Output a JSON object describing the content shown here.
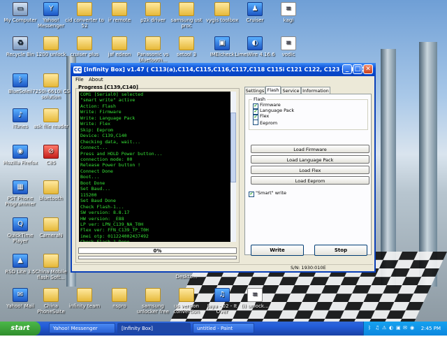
{
  "desktop_icons": [
    {
      "label": "My Computer",
      "kind": "pc",
      "glyph": "▭"
    },
    {
      "label": "Yahoo! Messenger",
      "kind": "app",
      "glyph": "Y"
    },
    {
      "label": "cid converter to 52",
      "kind": "folder",
      "glyph": ""
    },
    {
      "label": "ir remote",
      "kind": "folder",
      "glyph": ""
    },
    {
      "label": "p2k driver",
      "kind": "folder",
      "glyph": ""
    },
    {
      "label": "samsung ust proc",
      "kind": "folder",
      "glyph": ""
    },
    {
      "label": "vygis toolbox",
      "kind": "folder",
      "glyph": ""
    },
    {
      "label": "Cruiser",
      "kind": "app",
      "glyph": "♟"
    },
    {
      "label": "kagi",
      "kind": "doc",
      "glyph": "≡"
    },
    {
      "label": "Recycle Bin",
      "kind": "pc",
      "glyph": "♻"
    },
    {
      "label": "1200 unlock",
      "kind": "folder",
      "glyph": ""
    },
    {
      "label": "cruiser plus",
      "kind": "folder",
      "glyph": ""
    },
    {
      "label": "jaf edeon",
      "kind": "folder",
      "glyph": ""
    },
    {
      "label": "Panasonic vs bluetooth...",
      "kind": "folder",
      "glyph": ""
    },
    {
      "label": "setool 3",
      "kind": "folder",
      "glyph": ""
    },
    {
      "label": "IMEIcheck",
      "kind": "app",
      "glyph": "▣"
    },
    {
      "label": "LimeWire 4.16.6",
      "kind": "app",
      "glyph": "◐"
    },
    {
      "label": "vodic",
      "kind": "doc",
      "glyph": "≡"
    },
    {
      "label": "BlueSoleil",
      "kind": "app",
      "glyph": "ᛒ"
    },
    {
      "label": "7250i-6610i CS solution",
      "kind": "folder",
      "glyph": ""
    },
    {
      "label": "iTunes",
      "kind": "app",
      "glyph": "♪"
    },
    {
      "label": "ask file reader",
      "kind": "folder",
      "glyph": ""
    },
    {
      "label": "Mozilla Firefox",
      "kind": "app",
      "glyph": "◉"
    },
    {
      "label": "C85",
      "kind": "red",
      "glyph": "⊘"
    },
    {
      "label": "PST Phone Programmer",
      "kind": "app",
      "glyph": "▦"
    },
    {
      "label": "bluetooth",
      "kind": "folder",
      "glyph": ""
    },
    {
      "label": "QuickTime Player",
      "kind": "app",
      "glyph": "Q"
    },
    {
      "label": "CameraN",
      "kind": "folder",
      "glyph": ""
    },
    {
      "label": "RSD Lite 3.5",
      "kind": "app",
      "glyph": "▲"
    },
    {
      "label": "China Mobile flash Soft...",
      "kind": "folder",
      "glyph": ""
    },
    {
      "label": "Yahoo! Mail",
      "kind": "app",
      "glyph": "✉"
    },
    {
      "label": "China PhoneSuite",
      "kind": "folder",
      "glyph": ""
    },
    {
      "label": "infinity team",
      "kind": "folder",
      "glyph": ""
    },
    {
      "label": "nspro",
      "kind": "folder",
      "glyph": ""
    },
    {
      "label": "samsung unlocker free",
      "kind": "folder",
      "glyph": ""
    },
    {
      "label": "us version convertion",
      "kind": "folder",
      "glyph": ""
    },
    {
      "label": "Jaya - 02 - It Over",
      "kind": "app",
      "glyph": "♫"
    },
    {
      "label": "(i) unlock...",
      "kind": "doc",
      "glyph": "≡"
    },
    {
      "label": "Deskto...",
      "kind": "folder",
      "glyph": ""
    }
  ],
  "window": {
    "logo": "CC",
    "title": "[Infinity Box] v1.47    ( C113(a),C114,C115,C116,C117,C118 C115i C121 C122, C123 C136 C...",
    "minimize": "_",
    "maximize": "□",
    "close": "✕",
    "menu": [
      "File",
      "About"
    ],
    "progress_title": "Progress [C139,C140]",
    "log": [
      "COM1 [Serial0] selected",
      "\"smart write\" active",
      "Action: Flash",
      "Write: Firmware",
      "Write: Language Pack",
      "Write: Flex",
      "Skip: Eeprom",
      "Device: C139,C140",
      "Checking data, wait...",
      "Connect...",
      "Press and HOLD Power button...",
      "connection mode: 00",
      "Release Power button !",
      "Connect Done",
      "Boot...",
      "Boot Done",
      "Set Baud...",
      "115200",
      "Set Baud Done",
      "Check Flash-1...",
      "SW version: 8.8.17",
      "HW version: _E88",
      "LP ver: LPN_C139_NA_T0H",
      "Flex ver: FFN_C139_TP_T0H",
      "imei otp: 011224002437492",
      "Check Flash-1 Done"
    ],
    "progress_text": "0%",
    "progress_fraction": 0.0,
    "tabs": [
      {
        "label": "Settings",
        "active": false
      },
      {
        "label": "Flash",
        "active": true
      },
      {
        "label": "Service",
        "active": false
      },
      {
        "label": "Information",
        "active": false
      }
    ],
    "flash_group_label": "Flash",
    "checkboxes": [
      {
        "label": "Firmware",
        "checked": true
      },
      {
        "label": "Language Pack",
        "checked": true
      },
      {
        "label": "Flex",
        "checked": true
      },
      {
        "label": "Eeprom",
        "checked": false
      }
    ],
    "panel_buttons": [
      "Load Firmware",
      "Load Language Pack",
      "Load Flex",
      "Load Eeprom"
    ],
    "smart_write": {
      "label": "\"Smart\" write",
      "checked": true
    },
    "write_button": "Write",
    "stop_button": "Stop",
    "status": "S/N: 1930:010E"
  },
  "taskbar": {
    "start": "start",
    "tasks": [
      {
        "label": "Yahoo! Messenger",
        "active": false
      },
      {
        "label": "[Infinity Box]",
        "active": true
      },
      {
        "label": "untitled - Paint",
        "active": false
      }
    ],
    "tray_icons": [
      "ᛒ",
      "♫",
      "⚠",
      "◐",
      "▣",
      "✉",
      "◉"
    ],
    "clock": "2:45 PM"
  },
  "colors": {
    "log_text": "#37e437",
    "title_blue": "#0a4fd6",
    "taskbar": "#245edb",
    "start_green": "#3c9f3a"
  }
}
